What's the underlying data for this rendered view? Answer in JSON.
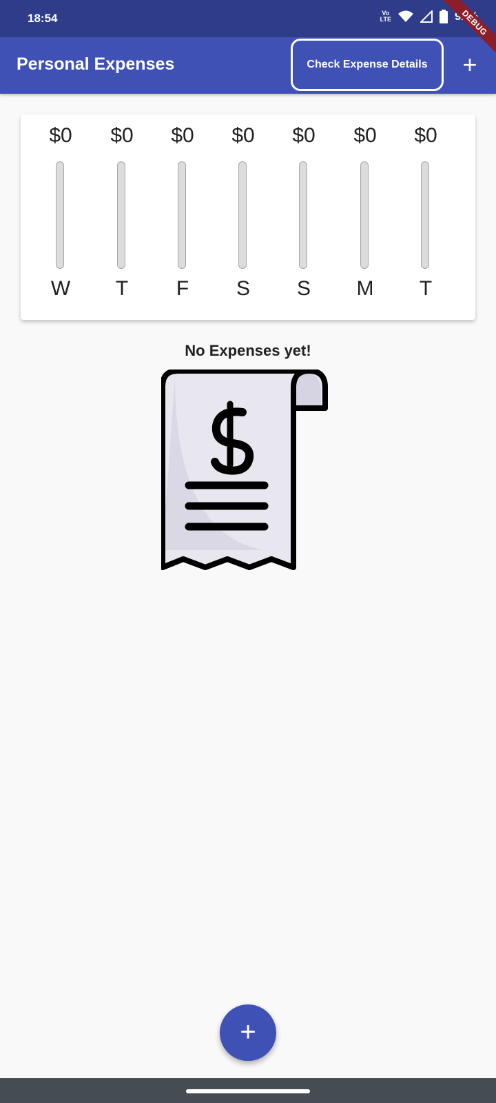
{
  "status_bar": {
    "time": "18:54",
    "volte_top": "Vo",
    "volte_bottom": "LTE",
    "battery": "92%",
    "icons": [
      "volte-icon",
      "wifi-icon",
      "signal-icon",
      "battery-icon"
    ]
  },
  "debug_banner": "DEBUG",
  "app_bar": {
    "title": "Personal Expenses",
    "details_button": "Check Expense Details",
    "add_icon": "+"
  },
  "chart": {
    "bars": [
      {
        "amount": "$0",
        "day": "W",
        "fill": 0
      },
      {
        "amount": "$0",
        "day": "T",
        "fill": 0
      },
      {
        "amount": "$0",
        "day": "F",
        "fill": 0
      },
      {
        "amount": "$0",
        "day": "S",
        "fill": 0
      },
      {
        "amount": "$0",
        "day": "S",
        "fill": 0
      },
      {
        "amount": "$0",
        "day": "M",
        "fill": 0
      },
      {
        "amount": "$0",
        "day": "T",
        "fill": 0
      }
    ]
  },
  "empty_state": {
    "title": "No Expenses yet!",
    "icon": "receipt-icon"
  },
  "fab": {
    "icon": "+"
  },
  "colors": {
    "primary": "#3f51b5",
    "status_bar": "#2f3c8a",
    "background": "#f9f9f9"
  }
}
